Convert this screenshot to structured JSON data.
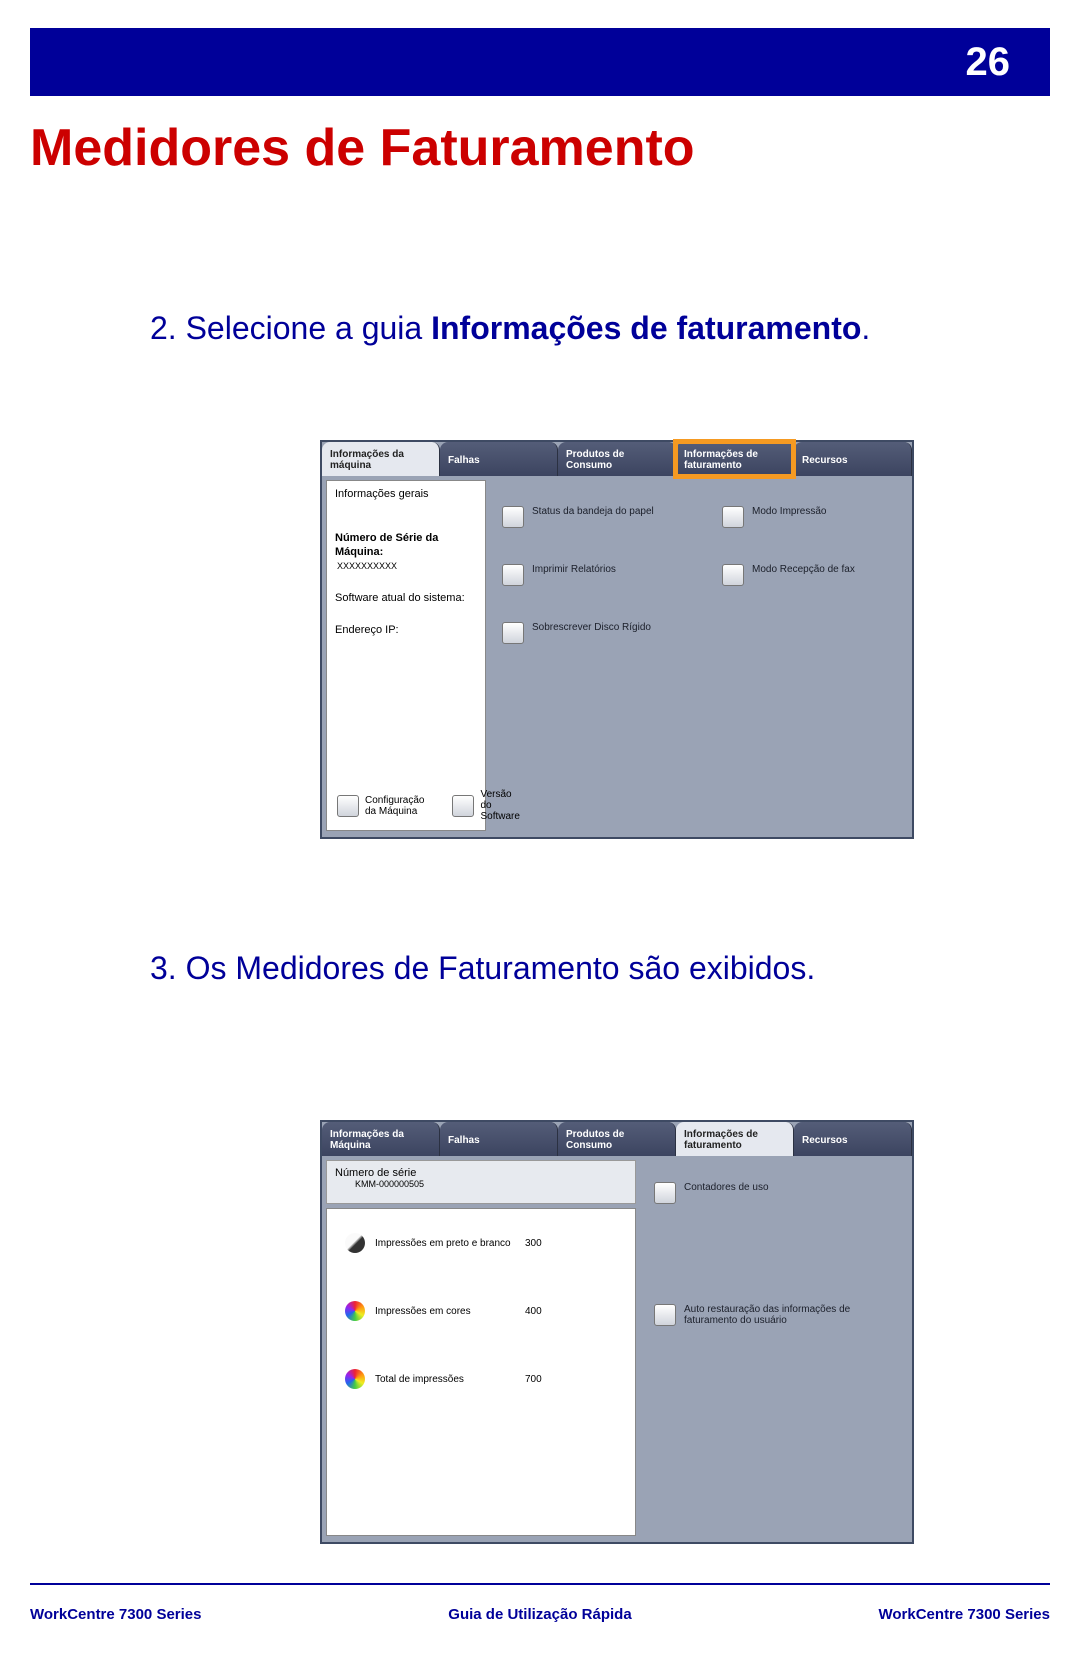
{
  "page_number": "26",
  "title": "Medidores de Faturamento",
  "step2_prefix": "2. Selecione a guia ",
  "step2_bold": "Informações de faturamento",
  "step2_suffix": ".",
  "step3": "3. Os Medidores de Faturamento são exibidos.",
  "screen1": {
    "tabs": [
      "Informações da máquina",
      "Falhas",
      "Produtos de Consumo",
      "Informações de faturamento",
      "Recursos"
    ],
    "left": {
      "info": "Informações gerais",
      "serial_label": "Número de Série da Máquina:",
      "serial": "XXXXXXXXXX",
      "sw": "Software atual do sistema:",
      "ip": "Endereço IP:",
      "cfg": "Configuração da Máquina",
      "ver": "Versão do Software"
    },
    "right": {
      "r1": "Status da bandeja do papel",
      "r2": "Modo Impressão",
      "r3": "Imprimir Relatórios",
      "r4": "Modo Recepção de fax",
      "r5": "Sobrescrever Disco Rígido"
    }
  },
  "screen2": {
    "tabs": [
      "Informações da Máquina",
      "Falhas",
      "Produtos de Consumo",
      "Informações de faturamento",
      "Recursos"
    ],
    "serial_label": "Número de série",
    "serial": "KMM-000000505",
    "rows": [
      {
        "label": "Impressões em preto e branco",
        "value": "300"
      },
      {
        "label": "Impressões em cores",
        "value": "400"
      },
      {
        "label": "Total de impressões",
        "value": "700"
      }
    ],
    "right": {
      "r1": "Contadores de uso",
      "r2": "Auto restauração das informações de faturamento do usuário"
    }
  },
  "footer": {
    "left": "WorkCentre 7300 Series",
    "center": "Guia de Utilização Rápida",
    "right": "WorkCentre 7300 Series"
  }
}
